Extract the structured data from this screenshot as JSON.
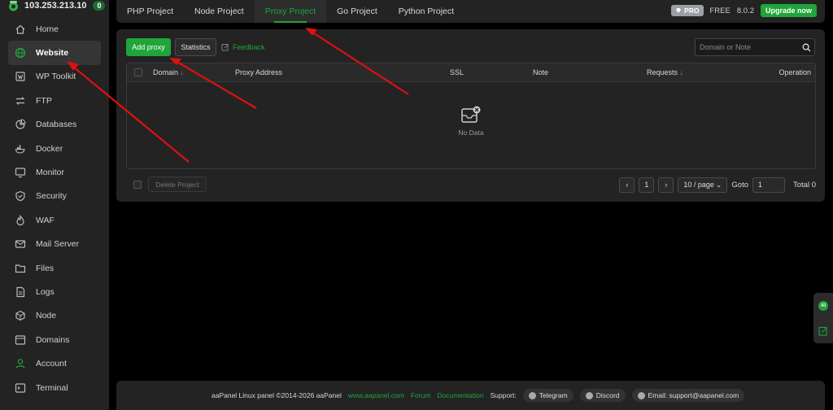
{
  "server": {
    "ip": "103.253.213.10",
    "badge": "0"
  },
  "sidebar": {
    "items": [
      {
        "label": "Home",
        "icon": "home-icon"
      },
      {
        "label": "Website",
        "icon": "globe-icon",
        "active": true
      },
      {
        "label": "WP Toolkit",
        "icon": "wordpress-icon"
      },
      {
        "label": "FTP",
        "icon": "transfer-icon"
      },
      {
        "label": "Databases",
        "icon": "database-icon"
      },
      {
        "label": "Docker",
        "icon": "docker-icon"
      },
      {
        "label": "Monitor",
        "icon": "monitor-icon"
      },
      {
        "label": "Security",
        "icon": "shield-icon"
      },
      {
        "label": "WAF",
        "icon": "firewall-icon"
      },
      {
        "label": "Mail Server",
        "icon": "mail-icon"
      },
      {
        "label": "Files",
        "icon": "folder-icon"
      },
      {
        "label": "Logs",
        "icon": "logs-icon"
      },
      {
        "label": "Node",
        "icon": "node-icon"
      },
      {
        "label": "Domains",
        "icon": "domains-icon"
      },
      {
        "label": "Account",
        "icon": "user-icon"
      },
      {
        "label": "Terminal",
        "icon": "terminal-icon"
      }
    ]
  },
  "tabs": [
    {
      "label": "PHP Project"
    },
    {
      "label": "Node Project"
    },
    {
      "label": "Proxy Project",
      "active": true
    },
    {
      "label": "Go Project"
    },
    {
      "label": "Python Project"
    }
  ],
  "topright": {
    "pro": "PRO",
    "free": "FREE",
    "version": "8.0.2",
    "upgrade": "Upgrade now"
  },
  "toolbar": {
    "add_label": "Add proxy",
    "stats_label": "Statistics",
    "feedback_label": "Feedback",
    "search_placeholder": "Domain or Note"
  },
  "table": {
    "columns": [
      "Domain",
      "Proxy Address",
      "SSL",
      "Note",
      "Requests",
      "Operation"
    ],
    "empty_text": "No Data"
  },
  "pager": {
    "delete_label": "Delete Project",
    "page": "1",
    "per_page": "10 / page",
    "goto_label": "Goto",
    "goto_value": "1",
    "total": "Total 0"
  },
  "footer": {
    "copyright": "aaPanel Linux panel ©2014-2026 aaPanel",
    "site": "www.aapanel.com",
    "forum": "Forum",
    "docs": "Documentation",
    "support_label": "Support:",
    "telegram": "Telegram",
    "discord": "Discord",
    "email": "Email: support@aapanel.com"
  },
  "float_tools": {
    "ai": "AI"
  },
  "colors": {
    "accent": "#20a53a",
    "arrow": "#e01010",
    "panel": "#232323"
  }
}
